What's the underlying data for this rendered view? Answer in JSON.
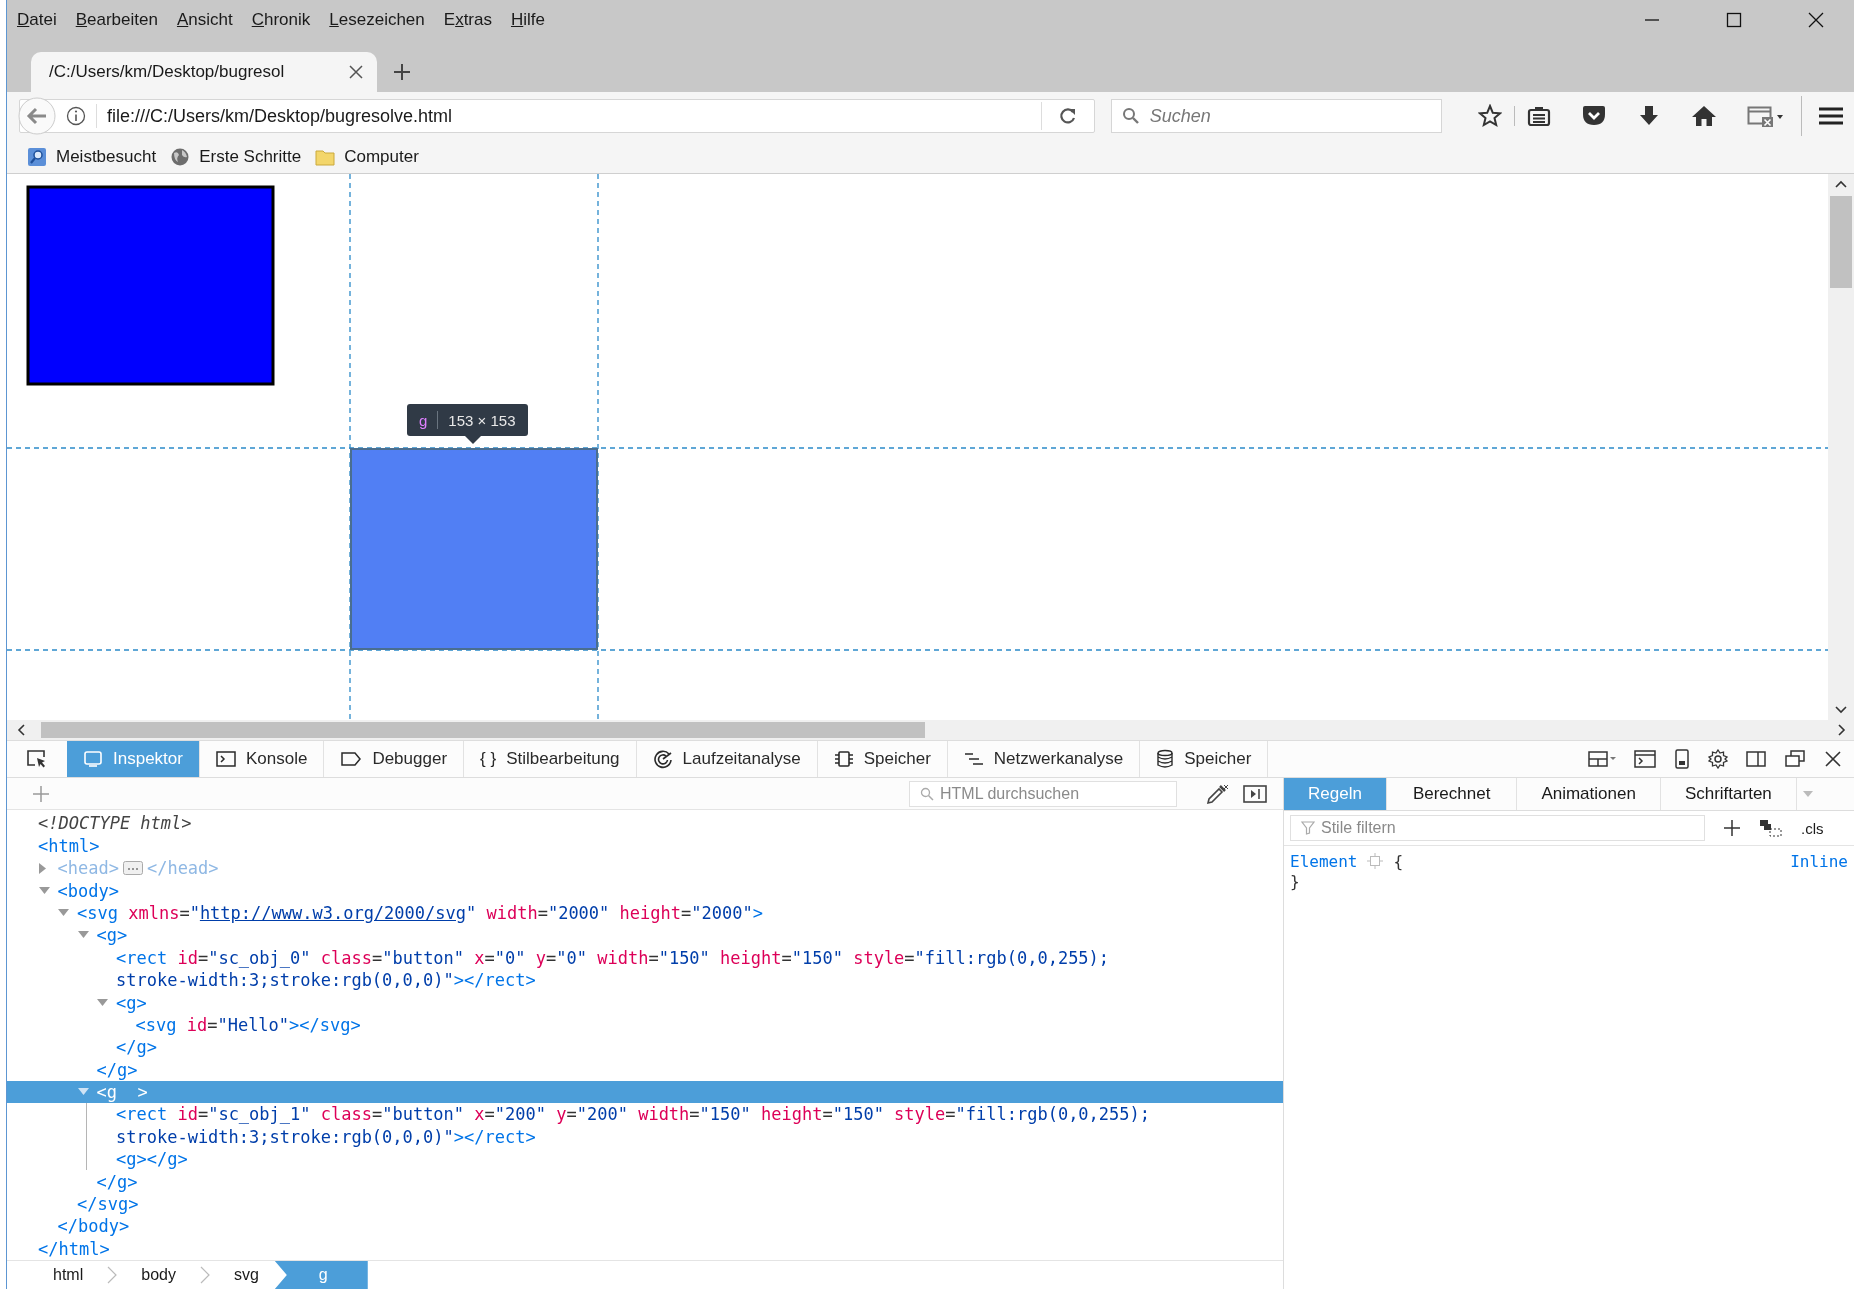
{
  "menu_bar": [
    {
      "key": "D",
      "post": "atei"
    },
    {
      "key": "B",
      "post": "earbeiten"
    },
    {
      "key": "A",
      "post": "nsicht"
    },
    {
      "key": "C",
      "post": "hronik"
    },
    {
      "key": "L",
      "post": "esezeichen"
    },
    {
      "pre": "E",
      "key": "x",
      "post": "tras"
    },
    {
      "key": "H",
      "post": "ilfe"
    }
  ],
  "tab": {
    "title": "/C:/Users/km/Desktop/bugresol"
  },
  "address_bar": {
    "value": "file:///C:/Users/km/Desktop/bugresolve.html"
  },
  "search": {
    "placeholder": "Suchen"
  },
  "bookmarks": [
    {
      "label": "Meistbesucht",
      "kind": "search"
    },
    {
      "label": "Erste Schritte",
      "kind": "globe"
    },
    {
      "label": "Computer",
      "kind": "folder"
    }
  ],
  "page": {
    "highlighter": {
      "tag": "g",
      "size": "153 × 153"
    }
  },
  "devtools": {
    "tabs": [
      {
        "label": "Inspektor",
        "kind": "inspector",
        "selected": true
      },
      {
        "label": "Konsole",
        "kind": "console",
        "selected": false
      },
      {
        "label": "Debugger",
        "kind": "debugger",
        "selected": false
      },
      {
        "label": "Stilbearbeitung",
        "kind": "style",
        "glyph": "{ }",
        "selected": false
      },
      {
        "label": "Laufzeitanalyse",
        "kind": "performance",
        "selected": false
      },
      {
        "label": "Speicher",
        "kind": "memory",
        "selected": false
      },
      {
        "label": "Netzwerkanalyse",
        "kind": "network",
        "selected": false
      },
      {
        "label": "Speicher",
        "kind": "storage",
        "selected": false
      }
    ],
    "markup_search": {
      "placeholder": "HTML durchsuchen"
    },
    "nodes": [
      {
        "tokens": [
          {
            "kind": "doctype",
            "text": "<!DOCTYPE html>"
          }
        ],
        "selected": false
      },
      {
        "tokens": [
          {
            "kind": "tag",
            "text": "<html>"
          }
        ],
        "selected": false,
        "close": [
          {
            "kind": "tag",
            "text": "</html>"
          }
        ],
        "children": [
          {
            "tokens": [
              {
                "kind": "dim",
                "text": "<head>"
              },
              {
                "kind": "more"
              },
              {
                "kind": "dim",
                "text": "</head>"
              }
            ],
            "expanded": false,
            "selected": false
          },
          {
            "tokens": [
              {
                "kind": "tag",
                "text": "<body>"
              }
            ],
            "expanded": true,
            "selected": false,
            "close": [
              {
                "kind": "tag",
                "text": "</body>"
              }
            ],
            "children": [
              {
                "tokens": [
                  {
                    "kind": "tag",
                    "text": "<svg"
                  },
                  {
                    "kind": "attr",
                    "text": " xmlns"
                  },
                  {
                    "kind": "punct",
                    "text": "="
                  },
                  {
                    "kind": "value",
                    "text": "\""
                  },
                  {
                    "kind": "link",
                    "text": "http://www.w3.org/2000/svg"
                  },
                  {
                    "kind": "value",
                    "text": "\""
                  },
                  {
                    "kind": "attr",
                    "text": " width"
                  },
                  {
                    "kind": "punct",
                    "text": "="
                  },
                  {
                    "kind": "value",
                    "text": "\"2000\""
                  },
                  {
                    "kind": "attr",
                    "text": " height"
                  },
                  {
                    "kind": "punct",
                    "text": "="
                  },
                  {
                    "kind": "value",
                    "text": "\"2000\""
                  },
                  {
                    "kind": "tag",
                    "text": ">"
                  }
                ],
                "expanded": true,
                "selected": false,
                "close": [
                  {
                    "kind": "tag",
                    "text": "</svg>"
                  }
                ],
                "children": [
                  {
                    "tokens": [
                      {
                        "kind": "tag",
                        "text": "<g>"
                      }
                    ],
                    "expanded": true,
                    "selected": false,
                    "close": [
                      {
                        "kind": "tag",
                        "text": "</g>"
                      }
                    ],
                    "children": [
                      {
                        "tokens": [
                          {
                            "kind": "tag",
                            "text": "<rect"
                          },
                          {
                            "kind": "attr",
                            "text": " id"
                          },
                          {
                            "kind": "punct",
                            "text": "="
                          },
                          {
                            "kind": "value",
                            "text": "\"sc_obj_0\""
                          },
                          {
                            "kind": "attr",
                            "text": " class"
                          },
                          {
                            "kind": "punct",
                            "text": "="
                          },
                          {
                            "kind": "value",
                            "text": "\"button\""
                          },
                          {
                            "kind": "attr",
                            "text": " x"
                          },
                          {
                            "kind": "punct",
                            "text": "="
                          },
                          {
                            "kind": "value",
                            "text": "\"0\""
                          },
                          {
                            "kind": "attr",
                            "text": " y"
                          },
                          {
                            "kind": "punct",
                            "text": "="
                          },
                          {
                            "kind": "value",
                            "text": "\"0\""
                          },
                          {
                            "kind": "attr",
                            "text": " width"
                          },
                          {
                            "kind": "punct",
                            "text": "="
                          },
                          {
                            "kind": "value",
                            "text": "\"150\""
                          },
                          {
                            "kind": "attr",
                            "text": " height"
                          },
                          {
                            "kind": "punct",
                            "text": "="
                          },
                          {
                            "kind": "value",
                            "text": "\"150\""
                          },
                          {
                            "kind": "attr",
                            "text": " style"
                          },
                          {
                            "kind": "punct",
                            "text": "="
                          },
                          {
                            "kind": "value",
                            "text": "\"fill:rgb(0,0,255);"
                          }
                        ],
                        "cont": [
                          {
                            "kind": "value",
                            "text": "stroke-width:3;stroke:rgb(0,0,0)\""
                          },
                          {
                            "kind": "tag",
                            "text": "></rect>"
                          }
                        ],
                        "selected": false
                      },
                      {
                        "tokens": [
                          {
                            "kind": "tag",
                            "text": "<g>"
                          }
                        ],
                        "expanded": true,
                        "selected": false,
                        "close": [
                          {
                            "kind": "tag",
                            "text": "</g>"
                          }
                        ],
                        "children": [
                          {
                            "tokens": [
                              {
                                "kind": "tag",
                                "text": "<svg"
                              },
                              {
                                "kind": "attr",
                                "text": " id"
                              },
                              {
                                "kind": "punct",
                                "text": "="
                              },
                              {
                                "kind": "value",
                                "text": "\"Hello\""
                              },
                              {
                                "kind": "tag",
                                "text": "></svg>"
                              }
                            ],
                            "selected": false
                          }
                        ]
                      }
                    ]
                  },
                  {
                    "tokens": [
                      {
                        "kind": "tag",
                        "text": "<g  >"
                      }
                    ],
                    "expanded": true,
                    "selected": true,
                    "close": [
                      {
                        "kind": "tag",
                        "text": "</g>"
                      }
                    ],
                    "children": [
                      {
                        "tokens": [
                          {
                            "kind": "tag",
                            "text": "<rect"
                          },
                          {
                            "kind": "attr",
                            "text": " id"
                          },
                          {
                            "kind": "punct",
                            "text": "="
                          },
                          {
                            "kind": "value",
                            "text": "\"sc_obj_1\""
                          },
                          {
                            "kind": "attr",
                            "text": " class"
                          },
                          {
                            "kind": "punct",
                            "text": "="
                          },
                          {
                            "kind": "value",
                            "text": "\"button\""
                          },
                          {
                            "kind": "attr",
                            "text": " x"
                          },
                          {
                            "kind": "punct",
                            "text": "="
                          },
                          {
                            "kind": "value",
                            "text": "\"200\""
                          },
                          {
                            "kind": "attr",
                            "text": " y"
                          },
                          {
                            "kind": "punct",
                            "text": "="
                          },
                          {
                            "kind": "value",
                            "text": "\"200\""
                          },
                          {
                            "kind": "attr",
                            "text": " width"
                          },
                          {
                            "kind": "punct",
                            "text": "="
                          },
                          {
                            "kind": "value",
                            "text": "\"150\""
                          },
                          {
                            "kind": "attr",
                            "text": " height"
                          },
                          {
                            "kind": "punct",
                            "text": "="
                          },
                          {
                            "kind": "value",
                            "text": "\"150\""
                          },
                          {
                            "kind": "attr",
                            "text": " style"
                          },
                          {
                            "kind": "punct",
                            "text": "="
                          },
                          {
                            "kind": "value",
                            "text": "\"fill:rgb(0,0,255);"
                          }
                        ],
                        "cont": [
                          {
                            "kind": "value",
                            "text": "stroke-width:3;stroke:rgb(0,0,0)\""
                          },
                          {
                            "kind": "tag",
                            "text": "></rect>"
                          }
                        ],
                        "selected": false
                      },
                      {
                        "tokens": [
                          {
                            "kind": "tag",
                            "text": "<g></g>"
                          }
                        ],
                        "selected": false
                      }
                    ]
                  }
                ]
              }
            ]
          }
        ]
      }
    ],
    "breadcrumbs": [
      {
        "label": "html",
        "selected": false
      },
      {
        "label": "body",
        "selected": false
      },
      {
        "label": "svg",
        "selected": false
      },
      {
        "label": "g",
        "selected": true
      }
    ],
    "sidebar": {
      "tabs": [
        {
          "label": "Regeln",
          "selected": true
        },
        {
          "label": "Berechnet",
          "selected": false
        },
        {
          "label": "Animationen",
          "selected": false
        },
        {
          "label": "Schriftarten",
          "selected": false
        }
      ],
      "filter": {
        "placeholder": "Stile filtern"
      },
      "cls": ".cls",
      "rule": {
        "selector": "Element",
        "open": "{",
        "close": "}",
        "source": "Inline"
      }
    }
  }
}
